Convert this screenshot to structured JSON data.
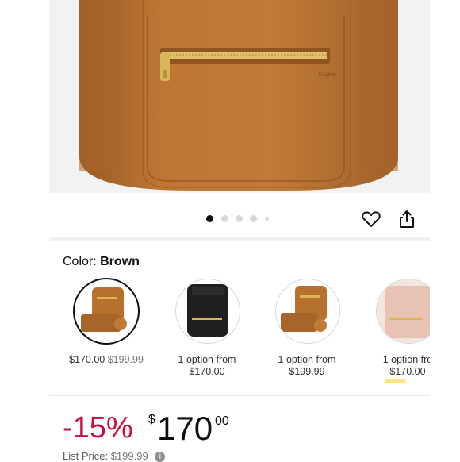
{
  "gallery": {
    "image": "brown-leather-backpack-photo",
    "brand_mark": "FAWN",
    "dot_count": 5,
    "active_dot": 0
  },
  "actions": {
    "wishlist_icon": "heart-icon",
    "share_icon": "share-icon"
  },
  "color": {
    "label": "Color:",
    "value": "Brown"
  },
  "swatches": [
    {
      "name": "brown-bundle",
      "price": "$170.00",
      "list_price": "$199.99",
      "selected": true,
      "color": "#b8702f"
    },
    {
      "name": "black",
      "line1": "1 option from",
      "line2": "$170.00",
      "color": "#1f1f1f"
    },
    {
      "name": "brown-bundle-2",
      "line1": "1 option from",
      "line2": "$199.99",
      "color": "#b8702f"
    },
    {
      "name": "blush",
      "line1": "1 option fro",
      "line2": "$170.00",
      "color": "#e8c2b3"
    }
  ],
  "price": {
    "discount": "-15%",
    "currency": "$",
    "whole": "170",
    "fraction": "00",
    "list_label": "List Price:",
    "list_value": "$199.99"
  },
  "colors": {
    "discount": "#cc0c39",
    "leather": "#b8702f",
    "zipper": "#d9b657"
  }
}
